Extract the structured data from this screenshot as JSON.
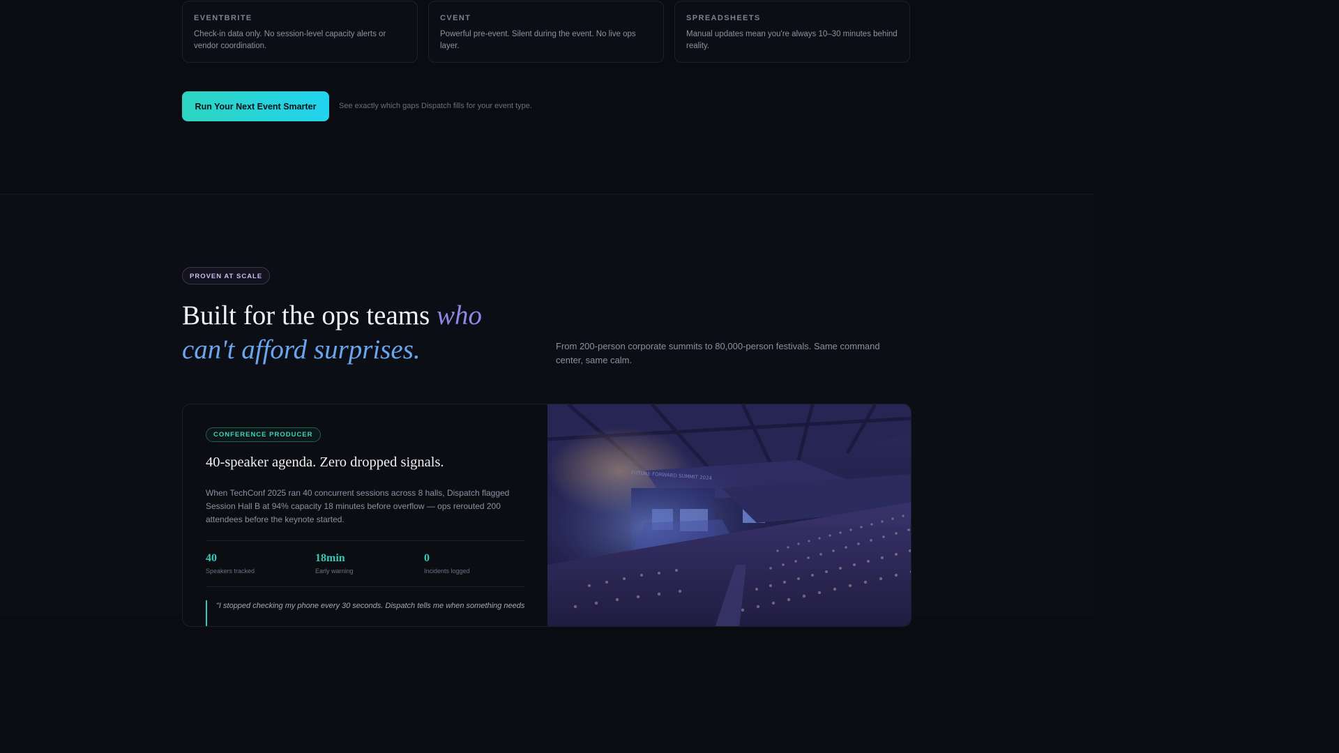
{
  "comparison": [
    {
      "label": "EVENTBRITE",
      "desc": "Check-in data only. No session-level capacity alerts or vendor coordination."
    },
    {
      "label": "CVENT",
      "desc": "Powerful pre-event. Silent during the event. No live ops layer."
    },
    {
      "label": "SPREADSHEETS",
      "desc": "Manual updates mean you're always 10–30 minutes behind reality."
    }
  ],
  "cta": {
    "button_label": "Run Your Next Event Smarter",
    "note": "See exactly which gaps Dispatch fills for your event type."
  },
  "proof": {
    "badge": "PROVEN AT SCALE",
    "headline_plain": "Built for the ops teams ",
    "headline_accent_1": "who",
    "headline_accent_2": "can't afford surprises.",
    "description": "From 200-person corporate summits to 80,000-person festivals. Same command center, same calm."
  },
  "case_study": {
    "role": "CONFERENCE PRODUCER",
    "title": "40-speaker agenda. Zero dropped signals.",
    "body": "When TechConf 2025 ran 40 concurrent sessions across 8 halls, Dispatch flagged Session Hall B at 94% capacity 18 minutes before overflow — ops rerouted 200 attendees before the keynote started.",
    "stats": [
      {
        "value": "40",
        "label": "Speakers tracked"
      },
      {
        "value": "18min",
        "label": "Early warning"
      },
      {
        "value": "0",
        "label": "Incidents logged"
      }
    ],
    "quote": "\"I stopped checking my phone every 30 seconds. Dispatch tells me when something needs",
    "image_screen_text": "FUTURE FORWARD SUMMIT 2024"
  },
  "colors": {
    "background": "#0a0c12",
    "accent_teal": "#2dd4bf",
    "accent_purple": "#8f87e6",
    "accent_blue": "#6aa6ee"
  }
}
